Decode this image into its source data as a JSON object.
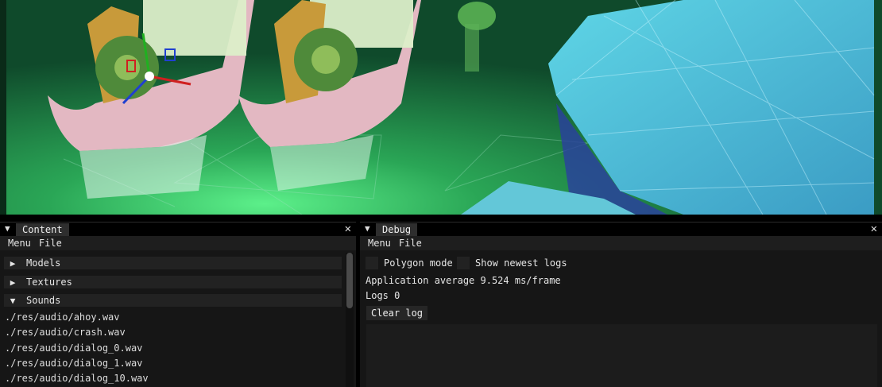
{
  "viewport": {
    "scene": "3d-scene-boats-with-gears",
    "colors": {
      "water": "#1c6a3c",
      "rock": "#4fc3d6",
      "boat_hull": "#e3b8c2",
      "gear": "#4f8a3a",
      "crane": "#c89a3a"
    }
  },
  "content": {
    "tab_title": "Content",
    "close_label": "✕",
    "collapse_icon": "triangle-down-icon",
    "menu": [
      "Menu",
      "File"
    ],
    "sections": [
      {
        "label": "Models",
        "expanded": false,
        "icon": "triangle-right-icon"
      },
      {
        "label": "Textures",
        "expanded": false,
        "icon": "triangle-right-icon"
      },
      {
        "label": "Sounds",
        "expanded": true,
        "icon": "triangle-down-icon"
      }
    ],
    "sound_files": [
      "./res/audio/ahoy.wav",
      "./res/audio/crash.wav",
      "./res/audio/dialog_0.wav",
      "./res/audio/dialog_1.wav",
      "./res/audio/dialog_10.wav"
    ]
  },
  "debug": {
    "tab_title": "Debug",
    "close_label": "✕",
    "menu": [
      "Menu",
      "File"
    ],
    "polygon_mode_label": "Polygon mode",
    "show_logs_label": "Show newest logs",
    "polygon_mode_checked": false,
    "show_logs_checked": false,
    "app_average": "Application average 9.524 ms/frame",
    "logs_count": "Logs 0",
    "clear_log_label": "Clear log"
  }
}
